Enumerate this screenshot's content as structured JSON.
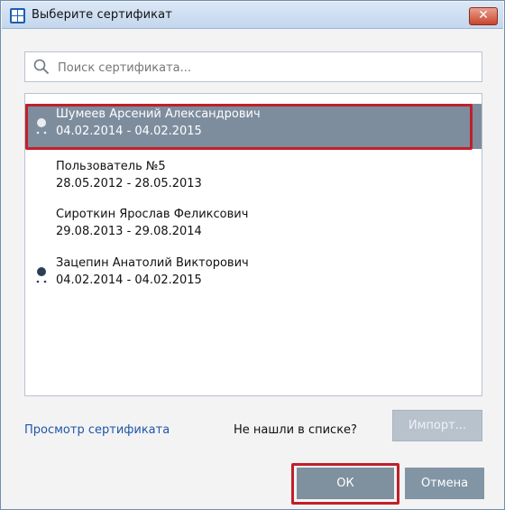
{
  "window": {
    "title": "Выберите сертификат",
    "close_label": "✕"
  },
  "search": {
    "placeholder": "Поиск сертификата..."
  },
  "certificates": [
    {
      "name": "Шумеев Арсений Александрович",
      "dates": "04.02.2014 - 04.02.2015",
      "selected": true,
      "icon": "person-icon"
    },
    {
      "name": "Пользователь №5",
      "dates": "28.05.2012 - 28.05.2013",
      "selected": false,
      "icon": ""
    },
    {
      "name": "Сироткин  Ярослав Феликсович",
      "dates": "29.08.2013 - 29.08.2014",
      "selected": false,
      "icon": ""
    },
    {
      "name": "Зацепин Анатолий Викторович",
      "dates": "04.02.2014 - 04.02.2015",
      "selected": false,
      "icon": "person-icon"
    }
  ],
  "footer": {
    "view_link": "Просмотр сертификата",
    "not_found": "Не нашли в списке?",
    "import_label": "Импорт...",
    "ok_label": "ОК",
    "cancel_label": "Отмена"
  },
  "colors": {
    "selection": "#7e8d9e",
    "highlight_frame": "#c0202a",
    "link": "#1f56a8",
    "title_icon": "#1b5fae"
  }
}
